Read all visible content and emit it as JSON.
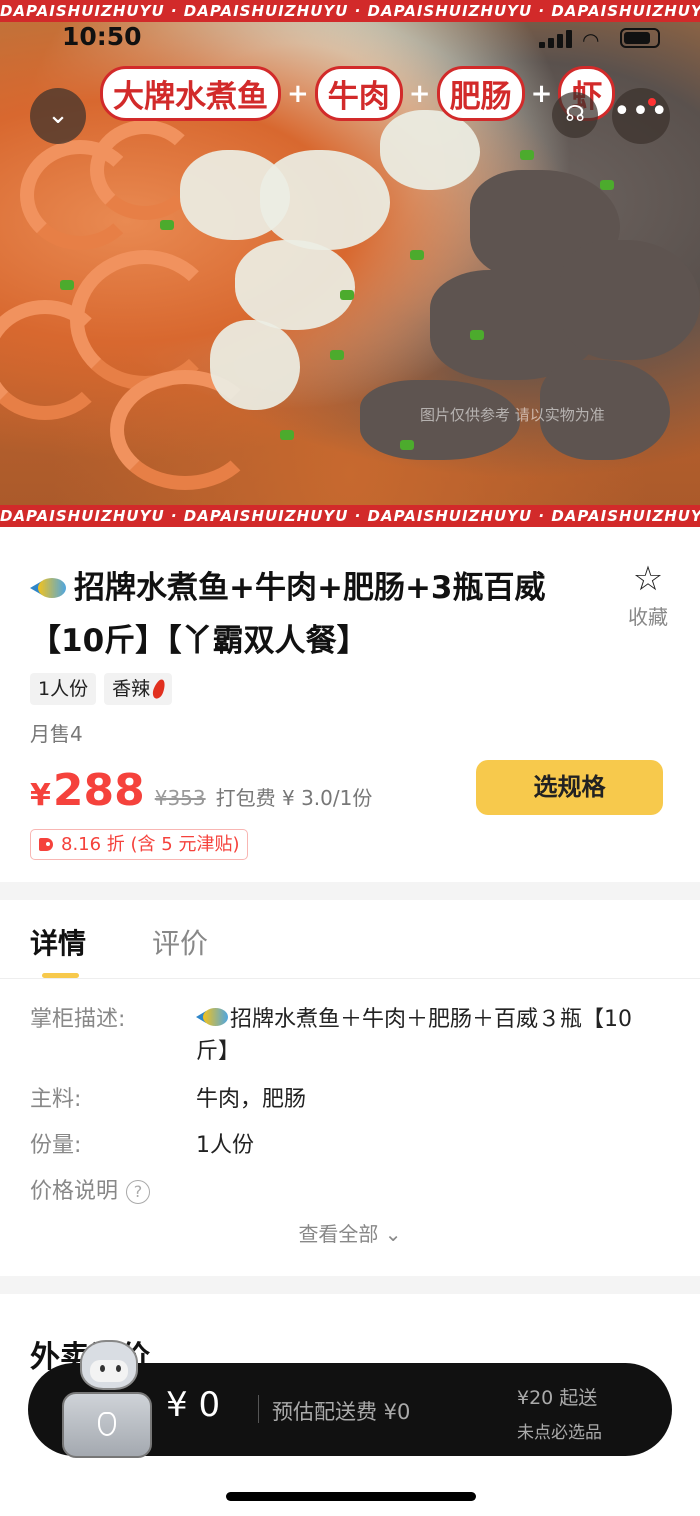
{
  "status_bar": {
    "time": "10:50"
  },
  "hero": {
    "strip_text": "DAPAISHUIZHUYU · DAPAISHUIZHUYU · DAPAISHUIZHUYU · DAPAISHUIZHUYU",
    "badges": [
      "大牌水煮鱼",
      "牛肉",
      "肥肠",
      "虾"
    ],
    "plus": "+",
    "watermark": "图片仅供参考 请以实物为准"
  },
  "product": {
    "title": "招牌水煮鱼+牛肉+肥肠+3瓶百威【10斤】【丫霸双人餐】",
    "favorite_label": "收藏",
    "tags": [
      "1人份",
      "香辣"
    ],
    "monthly_sales": "月售4",
    "currency": "¥",
    "price": "288",
    "original_price": "¥353",
    "packing_fee": "打包费 ¥ 3.0/1份",
    "spec_button": "选规格",
    "discount": "8.16 折 (含 5 元津贴)"
  },
  "detail": {
    "tabs": [
      "详情",
      "评价"
    ],
    "rows": [
      {
        "key": "掌柜描述:",
        "value": "招牌水煮鱼＋牛肉＋肥肠＋百威３瓶【10斤】"
      },
      {
        "key": "主料:",
        "value": "牛肉，肥肠"
      },
      {
        "key": "份量:",
        "value": "1人份"
      },
      {
        "key": "价格说明",
        "value": ""
      }
    ],
    "help_icon": "?",
    "see_all": "查看全部"
  },
  "reviews": {
    "title": "外卖评价"
  },
  "cart": {
    "amount": "¥ 0",
    "delivery_fee": "预估配送费 ¥0",
    "min_order": "¥20 起送",
    "required_item": "未点必选品"
  },
  "icons": {
    "back": "chevron-down-icon",
    "service": "customer-service-icon",
    "more": "more-icon",
    "favorite": "star-icon"
  },
  "colors": {
    "accent": "#f5423c",
    "button": "#f7c94c",
    "brand_red": "#d22a2a"
  }
}
